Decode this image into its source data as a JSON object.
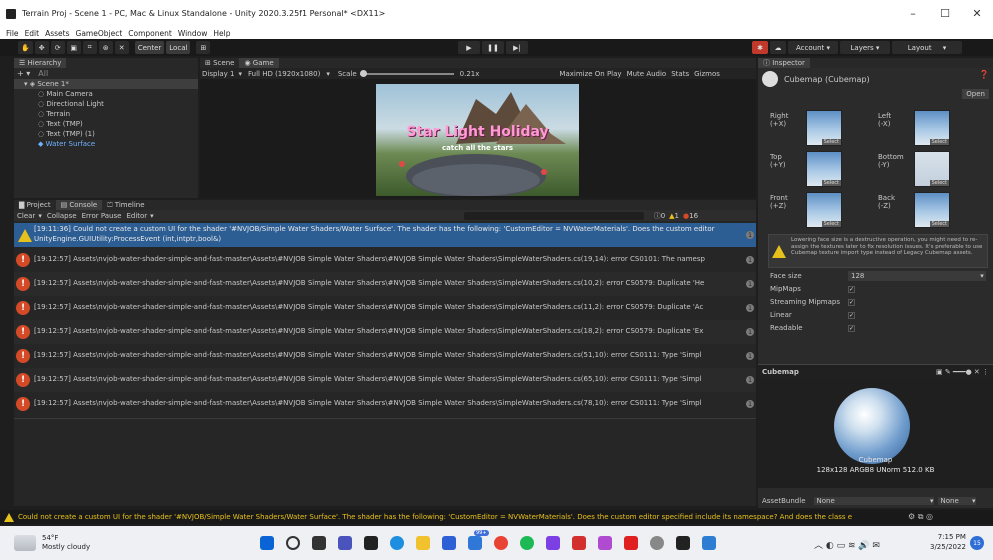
{
  "window": {
    "title": "Terrain Proj - Scene 1 - PC, Mac & Linux Standalone - Unity 2020.3.25f1 Personal* <DX11>",
    "minimize": "–",
    "maximize": "☐",
    "close": "✕"
  },
  "menu": [
    "File",
    "Edit",
    "Assets",
    "GameObject",
    "Component",
    "Window",
    "Help"
  ],
  "toolbar": {
    "center": "Center",
    "local": "Local",
    "account": "Account",
    "layers": "Layers",
    "layout": "Layout"
  },
  "hierarchy": {
    "tab": "Hierarchy",
    "search_placeholder": "All",
    "scene": "Scene 1*",
    "items": [
      "Main Camera",
      "Directional Light",
      "Terrain",
      "Text (TMP)",
      "Text (TMP) (1)",
      "Water Surface"
    ]
  },
  "game": {
    "tab_scene": "Scene",
    "tab_game": "Game",
    "display": "Display 1",
    "resolution": "Full HD (1920x1080)",
    "scale_label": "Scale",
    "scale_value": "0.21x",
    "options": [
      "Maximize On Play",
      "Mute Audio",
      "Stats",
      "Gizmos"
    ],
    "title_text": "Star Light Holiday",
    "subtitle_text": "catch all the stars"
  },
  "console": {
    "tabs": [
      "Project",
      "Console",
      "Timeline"
    ],
    "buttons": [
      "Clear",
      "Collapse",
      "Error Pause",
      "Editor"
    ],
    "counts": {
      "info": "0",
      "warn": "1",
      "error": "16"
    },
    "rows": [
      {
        "kind": "warn",
        "text": "[19:11:36] Could not create a custom UI for the shader '#NVJOB/Simple Water Shaders/Water Surface'. The shader has the following: 'CustomEditor = NVWaterMaterials'. Does the custom editor",
        "text2": "UnityEngine.GUIUtility:ProcessEvent (int,intptr,bool&)",
        "count": "1"
      },
      {
        "kind": "error",
        "text": "[19:12:57] Assets\\nvjob-water-shader-simple-and-fast-master\\Assets\\#NVJOB Simple Water Shaders\\#NVJOB Simple Water Shaders\\SimpleWaterShaders.cs(19,14): error CS0101: The namesp",
        "count": "1"
      },
      {
        "kind": "error",
        "text": "[19:12:57] Assets\\nvjob-water-shader-simple-and-fast-master\\Assets\\#NVJOB Simple Water Shaders\\#NVJOB Simple Water Shaders\\SimpleWaterShaders.cs(10,2): error CS0579: Duplicate 'He",
        "count": "1"
      },
      {
        "kind": "error",
        "text": "[19:12:57] Assets\\nvjob-water-shader-simple-and-fast-master\\Assets\\#NVJOB Simple Water Shaders\\#NVJOB Simple Water Shaders\\SimpleWaterShaders.cs(11,2): error CS0579: Duplicate 'Ac",
        "count": "1"
      },
      {
        "kind": "error",
        "text": "[19:12:57] Assets\\nvjob-water-shader-simple-and-fast-master\\Assets\\#NVJOB Simple Water Shaders\\#NVJOB Simple Water Shaders\\SimpleWaterShaders.cs(18,2): error CS0579: Duplicate 'Ex",
        "count": "1"
      },
      {
        "kind": "error",
        "text": "[19:12:57] Assets\\nvjob-water-shader-simple-and-fast-master\\Assets\\#NVJOB Simple Water Shaders\\#NVJOB Simple Water Shaders\\SimpleWaterShaders.cs(51,10): error CS0111: Type 'Simpl",
        "count": "1"
      },
      {
        "kind": "error",
        "text": "[19:12:57] Assets\\nvjob-water-shader-simple-and-fast-master\\Assets\\#NVJOB Simple Water Shaders\\#NVJOB Simple Water Shaders\\SimpleWaterShaders.cs(65,10): error CS0111: Type 'Simpl",
        "count": "1"
      },
      {
        "kind": "error",
        "text": "[19:12:57] Assets\\nvjob-water-shader-simple-and-fast-master\\Assets\\#NVJOB Simple Water Shaders\\#NVJOB Simple Water Shaders\\SimpleWaterShaders.cs(78,10): error CS0111: Type 'Simpl",
        "count": "1"
      }
    ]
  },
  "statusbar": {
    "text": "Could not create a custom UI for the shader '#NVJOB/Simple Water Shaders/Water Surface'. The shader has the following: 'CustomEditor = NVWaterMaterials'. Does the custom editor specified include its namespace? And does the class e"
  },
  "inspector": {
    "tab": "Inspector",
    "asset_name": "Cubemap (Cubemap)",
    "open_button": "Open",
    "faces": [
      {
        "name": "Right",
        "axis": "(+X)"
      },
      {
        "name": "Left",
        "axis": "(-X)"
      },
      {
        "name": "Top",
        "axis": "(+Y)"
      },
      {
        "name": "Bottom",
        "axis": "(-Y)"
      },
      {
        "name": "Front",
        "axis": "(+Z)"
      },
      {
        "name": "Back",
        "axis": "(-Z)"
      }
    ],
    "select_label": "Select",
    "warning": "Lowering face size is a destructive operation, you might need to re-assign the textures later to fix resolution issues. It's preferable to use Cubemap texture import type instead of Legacy Cubemap assets.",
    "face_size_label": "Face size",
    "face_size_value": "128",
    "toggles": [
      "MipMaps",
      "Streaming Mipmaps",
      "Linear",
      "Readable"
    ],
    "preview_title": "Cubemap",
    "preview_caption": "Cubemap",
    "preview_info": "128x128 ARGB8 UNorm  512.0 KB",
    "assetbundle_label": "AssetBundle",
    "assetbundle_value": "None",
    "assetbundle_variant": "None"
  },
  "taskbar": {
    "weather_temp": "54°F",
    "weather_desc": "Mostly cloudy",
    "time": "7:15 PM",
    "date": "3/25/2022",
    "badge": "99+",
    "notif": "15"
  }
}
